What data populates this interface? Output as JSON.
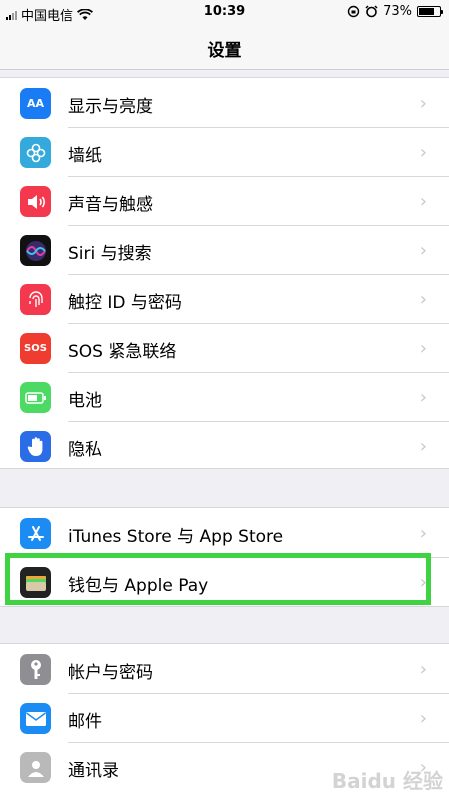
{
  "status": {
    "carrier": "中国电信",
    "time": "10:39",
    "battery": "73%",
    "battery_level": 0.73
  },
  "nav": {
    "title": "设置"
  },
  "groups": [
    {
      "rows": [
        {
          "label": "显示与亮度",
          "icon": "display-brightness-icon",
          "color": "#1a7cf4"
        },
        {
          "label": "墙纸",
          "icon": "wallpaper-icon",
          "color": "#34aadc"
        },
        {
          "label": "声音与触感",
          "icon": "sound-icon",
          "color": "#f4394f"
        },
        {
          "label": "Siri 与搜索",
          "icon": "siri-icon",
          "color": "#111111"
        },
        {
          "label": "触控 ID 与密码",
          "icon": "touch-id-icon",
          "color": "#f4394f"
        },
        {
          "label": "SOS 紧急联络",
          "icon": "sos-icon",
          "color": "#ef3b30"
        },
        {
          "label": "电池",
          "icon": "battery-icon",
          "color": "#4cd964"
        },
        {
          "label": "隐私",
          "icon": "privacy-hand-icon",
          "color": "#2a6de6"
        }
      ]
    },
    {
      "rows": [
        {
          "label": "iTunes Store 与 App Store",
          "icon": "app-store-icon",
          "color": "#1a8cf4"
        },
        {
          "label": "钱包与 Apple Pay",
          "icon": "wallet-icon",
          "color": "#222222"
        }
      ]
    },
    {
      "rows": [
        {
          "label": "帐户与密码",
          "icon": "key-icon",
          "color": "#8e8e93"
        },
        {
          "label": "邮件",
          "icon": "mail-icon",
          "color": "#1a8cf4"
        },
        {
          "label": "通讯录",
          "icon": "contacts-icon",
          "color": "#a7a7a7"
        }
      ]
    }
  ],
  "sos_text": "SOS",
  "watermark": "Baidu 经验"
}
